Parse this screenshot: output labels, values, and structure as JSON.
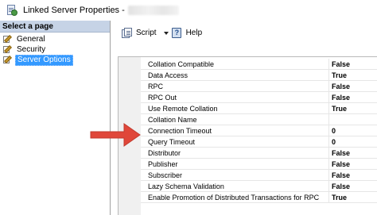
{
  "window": {
    "title": "Linked Server Properties -",
    "accent": "#3399ff",
    "header_bg": "#c6d3e6"
  },
  "left_pane": {
    "header": "Select a page",
    "items": [
      {
        "label": "General",
        "icon": "wrench-page-icon",
        "selected": false
      },
      {
        "label": "Security",
        "icon": "wrench-page-icon",
        "selected": false
      },
      {
        "label": "Server Options",
        "icon": "wrench-page-icon",
        "selected": true
      }
    ]
  },
  "toolbar": {
    "script_label": "Script",
    "help_label": "Help"
  },
  "properties": [
    {
      "name": "Collation Compatible",
      "value": "False"
    },
    {
      "name": "Data Access",
      "value": "True"
    },
    {
      "name": "RPC",
      "value": "False"
    },
    {
      "name": "RPC Out",
      "value": "False"
    },
    {
      "name": "Use Remote Collation",
      "value": "True"
    },
    {
      "name": "Collation Name",
      "value": ""
    },
    {
      "name": "Connection Timeout",
      "value": "0"
    },
    {
      "name": "Query Timeout",
      "value": "0"
    },
    {
      "name": "Distributor",
      "value": "False"
    },
    {
      "name": "Publisher",
      "value": "False"
    },
    {
      "name": "Subscriber",
      "value": "False"
    },
    {
      "name": "Lazy Schema Validation",
      "value": "False"
    },
    {
      "name": "Enable Promotion of Distributed Transactions for RPC",
      "value": "True"
    }
  ],
  "annotation": {
    "arrow_color": "#e0473a",
    "icon": "red-arrow-icon"
  }
}
